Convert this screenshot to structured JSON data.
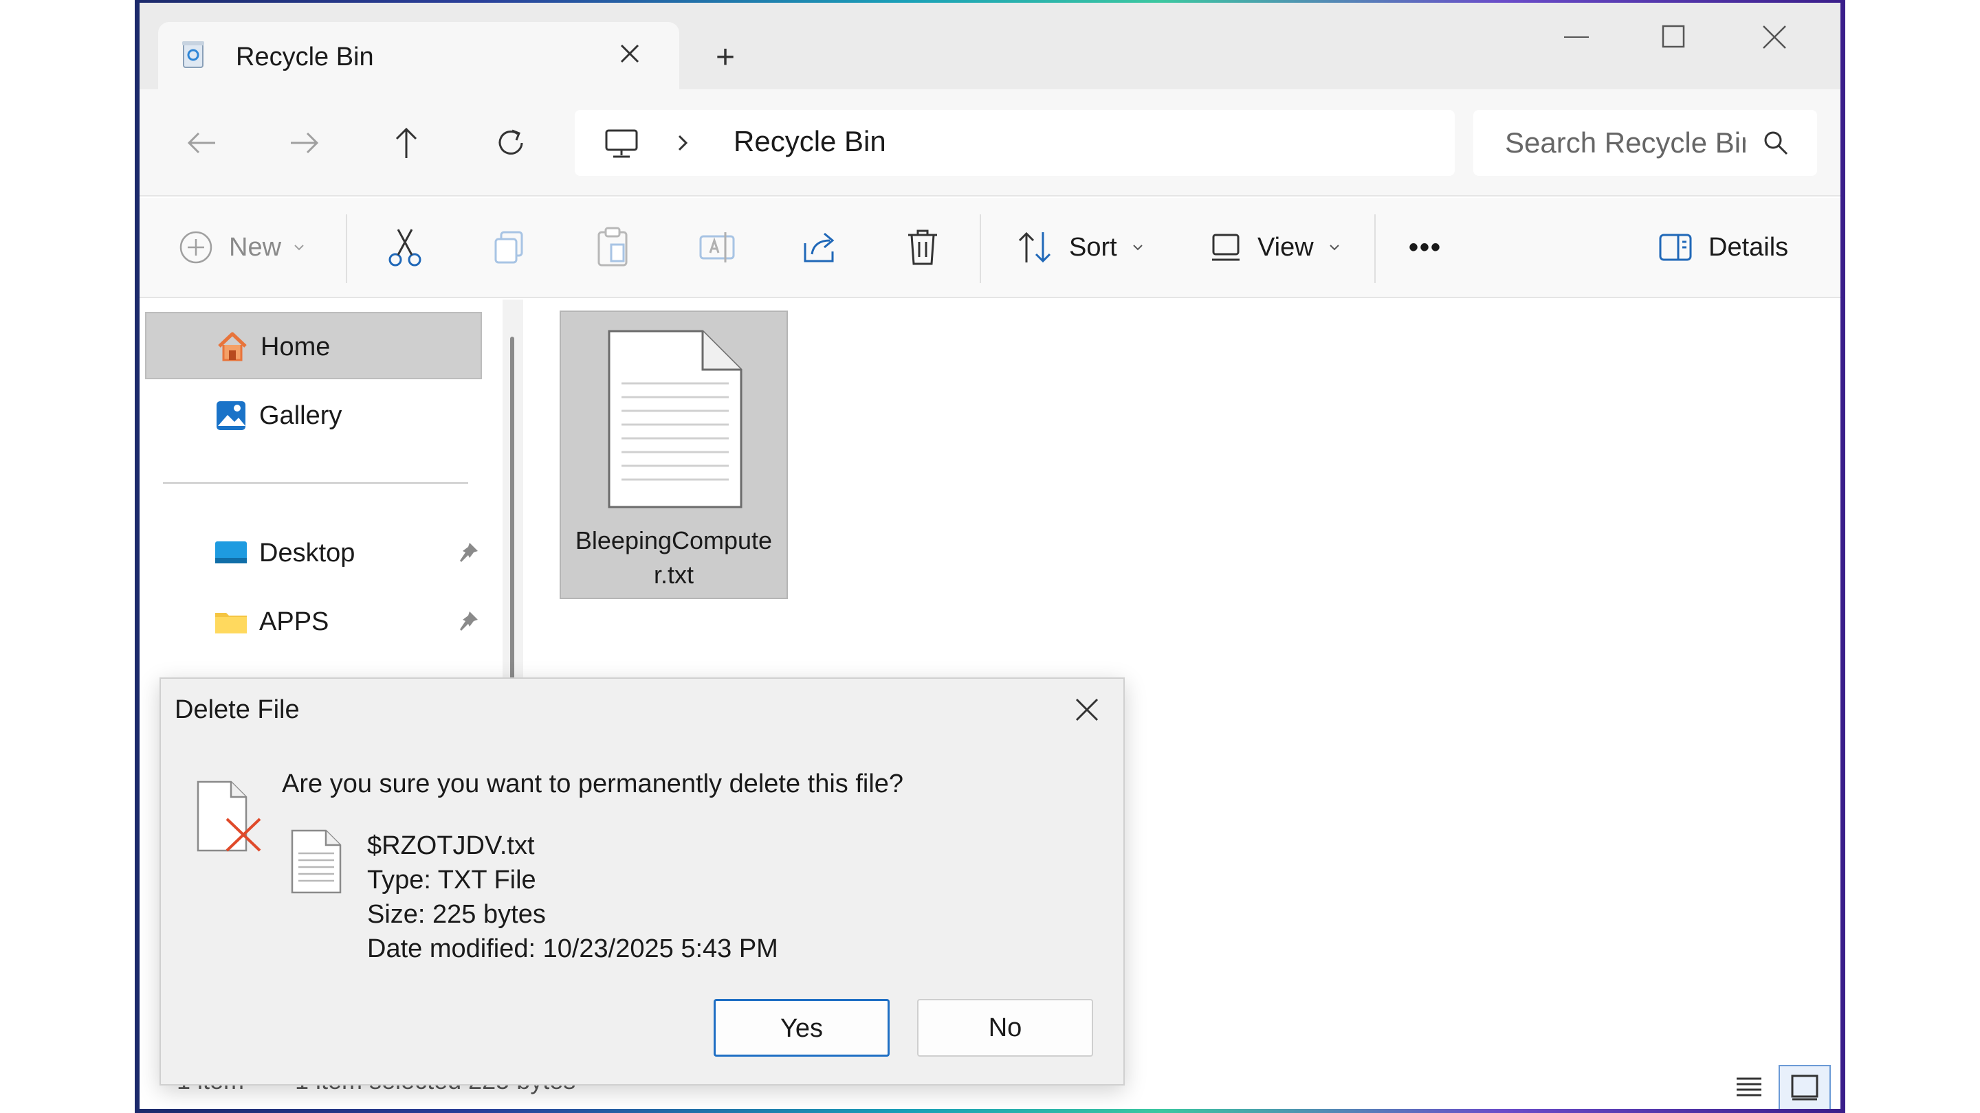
{
  "window": {
    "tab_title": "Recycle Bin",
    "new_tab_symbol": "+"
  },
  "address": {
    "location": "Recycle Bin",
    "search_placeholder": "Search Recycle Bin"
  },
  "commands": {
    "new": "New",
    "sort": "Sort",
    "view": "View",
    "more": "•••",
    "details": "Details"
  },
  "sidebar": {
    "items": [
      {
        "label": "Home",
        "icon": "home-icon"
      },
      {
        "label": "Gallery",
        "icon": "gallery-icon"
      },
      {
        "label": "Desktop",
        "icon": "desktop-icon",
        "pinned": true
      },
      {
        "label": "APPS",
        "icon": "folder-icon",
        "pinned": true
      }
    ]
  },
  "content": {
    "files": [
      {
        "name": "BleepingComputer.txt",
        "selected": true
      }
    ]
  },
  "status": {
    "item_count": "1 item",
    "selection": "1 item selected  225 bytes"
  },
  "dialog": {
    "title": "Delete File",
    "question": "Are you sure you want to permanently delete this file?",
    "file_name": "$RZOTJDV.txt",
    "type": "Type: TXT File",
    "size": "Size: 225 bytes",
    "date_modified": "Date modified: 10/23/2025 5:43 PM",
    "yes_label": "Yes",
    "no_label": "No"
  },
  "colors": {
    "accent": "#1f6fc4",
    "home_icon": "#e8743b",
    "folder_icon": "#f5c542",
    "desktop_icon": "#1e9be0",
    "delete_mark": "#e04a2a"
  }
}
